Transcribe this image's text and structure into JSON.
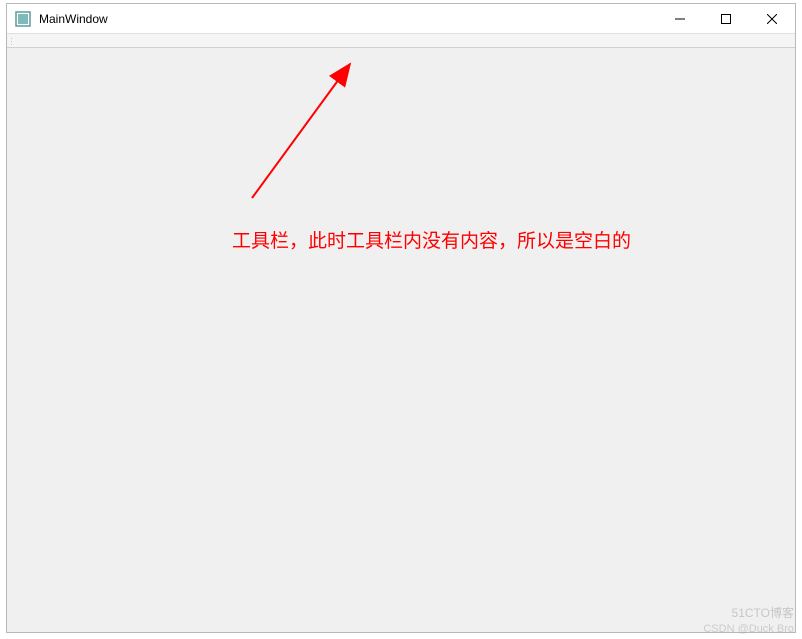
{
  "window": {
    "title": "MainWindow"
  },
  "annotation": {
    "text": "工具栏，此时工具栏内没有内容，所以是空白的"
  },
  "watermark": {
    "line1": "51CTO博客",
    "line2": "CSDN @Duck Bro"
  }
}
